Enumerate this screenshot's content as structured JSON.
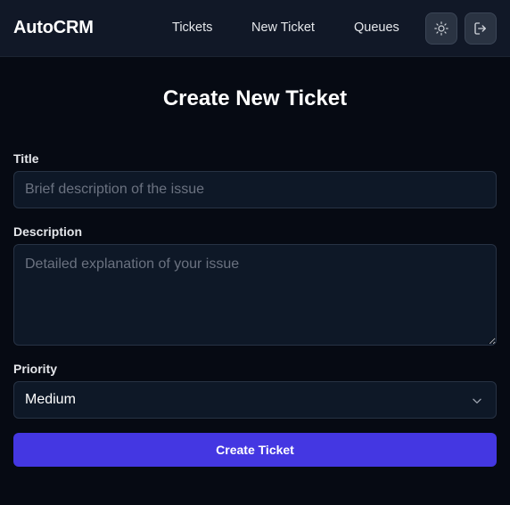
{
  "app": {
    "brand": "AutoCRM"
  },
  "nav": {
    "links": [
      "Tickets",
      "New Ticket",
      "Queues"
    ],
    "theme_icon": "sun-icon",
    "logout_icon": "logout-icon"
  },
  "form": {
    "heading": "Create New Ticket",
    "title": {
      "label": "Title",
      "placeholder": "Brief description of the issue",
      "value": ""
    },
    "description": {
      "label": "Description",
      "placeholder": "Detailed explanation of your issue",
      "value": ""
    },
    "priority": {
      "label": "Priority",
      "selected": "Medium"
    },
    "submit_label": "Create Ticket"
  },
  "colors": {
    "background": "#060a13",
    "navbar": "#111827",
    "accent": "#4437e2",
    "field_bg": "#0e1827",
    "placeholder": "#6b7280"
  }
}
